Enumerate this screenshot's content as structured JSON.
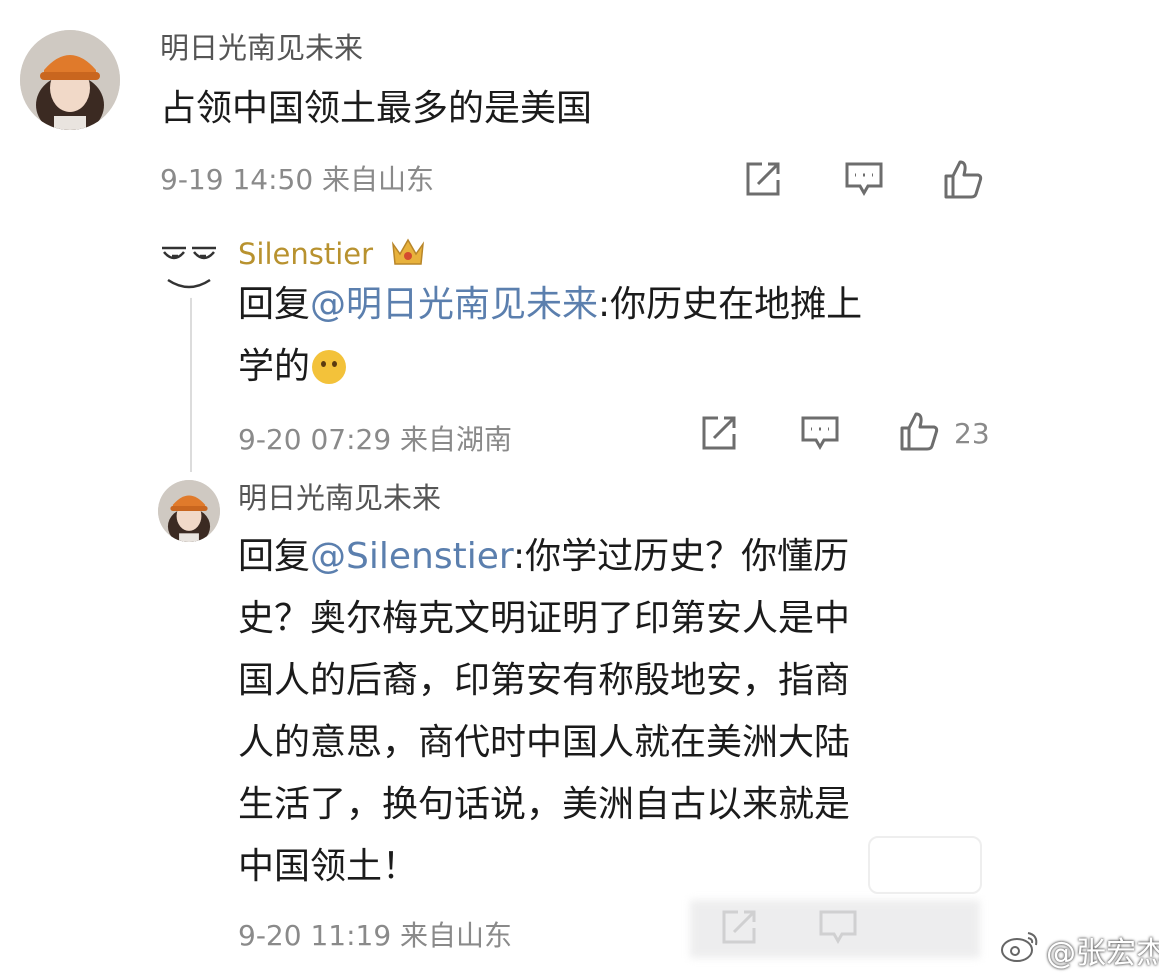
{
  "comment": {
    "username": "明日光南见未来",
    "text": "占领中国领土最多的是美国",
    "meta": "9-19 14:50 来自山东",
    "icons": [
      "share-icon",
      "comment-icon",
      "like-icon"
    ]
  },
  "reply1": {
    "username": "Silenstier",
    "badge_icon": "crown-icon",
    "prefix": "回复",
    "mention": "@明日光南见未来",
    "text_line1": ":你历史在地摊上",
    "text_line2": "学的",
    "emoji_icon": "thinking-face-icon",
    "meta": "9-20 07:29 来自湖南",
    "likes": "23",
    "icons": [
      "share-icon",
      "comment-icon",
      "like-icon"
    ]
  },
  "reply2": {
    "username": "明日光南见未来",
    "prefix": "回复",
    "mention": "@Silenstier",
    "lines": [
      ":你学过历史？你懂历",
      "史？奥尔梅克文明证明了印第安人是中",
      "国人的后裔，印第安有称殷地安，指商",
      "人的意思，商代时中国人就在美洲大陆",
      "生活了，换句话说，美洲自古以来就是",
      "中国领土！"
    ],
    "meta": "9-20 11:19 来自山东",
    "icons": [
      "share-icon",
      "comment-icon",
      "like-icon"
    ]
  },
  "watermark": {
    "text": "@张宏杰",
    "icon": "weibo-icon"
  },
  "colors": {
    "gold_username": "#b8922f",
    "mention": "#5b7fae",
    "meta": "#8a8a8a"
  }
}
